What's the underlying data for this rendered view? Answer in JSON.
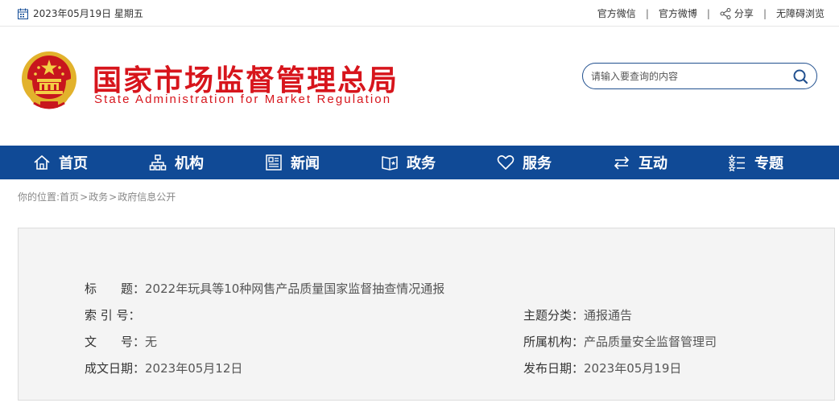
{
  "topbar": {
    "date": "2023年05月19日  星期五",
    "links": {
      "wechat": "官方微信",
      "weibo": "官方微博",
      "share": "分享",
      "accessible": "无障碍浏览"
    },
    "separator": "|"
  },
  "header": {
    "title": "国家市场监督管理总局",
    "subtitle": "State Administration for Market Regulation",
    "search_placeholder": "请输入要查询的内容"
  },
  "nav": {
    "items": [
      {
        "label": "首页",
        "icon": "home-icon"
      },
      {
        "label": "机构",
        "icon": "org-chart-icon"
      },
      {
        "label": "新闻",
        "icon": "news-icon"
      },
      {
        "label": "政务",
        "icon": "book-icon"
      },
      {
        "label": "服务",
        "icon": "heart-icon"
      },
      {
        "label": "互动",
        "icon": "arrows-exchange-icon"
      },
      {
        "label": "专题",
        "icon": "list-star-icon"
      }
    ]
  },
  "breadcrumb": {
    "prefix": "你的位置:",
    "items": [
      "首页",
      "政务",
      "政府信息公开"
    ],
    "sep": ">"
  },
  "info": {
    "title_label": "标　　题：",
    "title_value": "2022年玩具等10种网售产品质量国家监督抽查情况通报",
    "index_label": "索 引 号：",
    "index_value": "",
    "topic_label": "主题分类：",
    "topic_value": "通报通告",
    "docno_label": "文　　号：",
    "docno_value": "无",
    "org_label": "所属机构：",
    "org_value": "产品质量安全监督管理司",
    "created_label": "成文日期：",
    "created_value": "2023年05月12日",
    "published_label": "发布日期：",
    "published_value": "2023年05月19日"
  },
  "colors": {
    "brand_red": "#d7151c",
    "nav_blue": "#104a96",
    "search_border": "#21508f"
  }
}
